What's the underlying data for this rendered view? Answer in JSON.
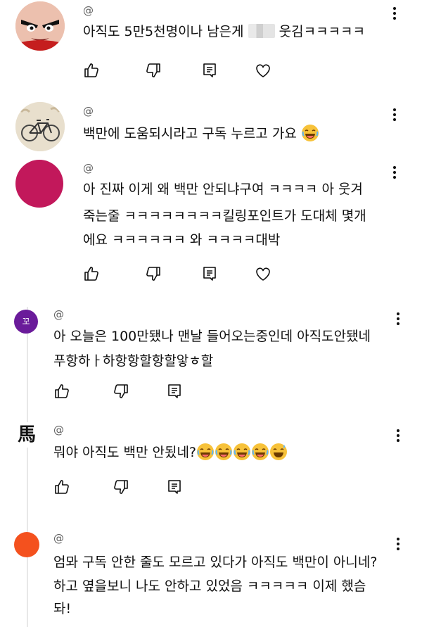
{
  "comments": [
    {
      "handle": "@",
      "text": [
        "아직도 5만5천명이나 남은게",
        "웃김ㅋㅋㅋㅋㅋ"
      ],
      "avatar": "cartoon-face-avatar"
    },
    {
      "handle": "@",
      "text": [
        "백만에 도움되시라고 구독 누르고 가요"
      ],
      "avatar": "bicycle-avatar"
    },
    {
      "handle": "@",
      "text": [
        "아 진짜 이게 왜 백만 안되냐구여 ㅋㅋㅋㅋ 아 웃겨",
        "죽는줄 ㅋㅋㅋㅋㅋㅋㅋㅋ킬링포인트가 도대체 몇개",
        "에요 ㅋㅋㅋㅋㅋㅋ 와 ㅋㅋㅋㅋ대박"
      ],
      "avatar": "magenta-circle-avatar"
    },
    {
      "handle": "@",
      "avatar_letter": "꼬",
      "text": [
        "아 오늘은 100만됐나 맨날 들어오는중인데 아직도안됐네",
        "푸항하ㅏ하항항할항할앟ㅎ할"
      ],
      "avatar": "letter-avatar"
    },
    {
      "handle": "@",
      "avatar_letter": "馬",
      "text": [
        "뭐야 아직도 백만 안됬네?"
      ],
      "avatar": "calligraphy-avatar"
    },
    {
      "handle": "@",
      "text": [
        "엄뫄 구독 안한 줄도 모르고 있다가 아직도 백만이 아니네?",
        "하고 옆을보니 나도 안하고 있었음 ㅋㅋㅋㅋㅋ 이제 했슴",
        "돠!"
      ],
      "avatar": "orange-circle-avatar"
    }
  ],
  "colors": {
    "text": "#0f0f0f",
    "secondary": "#606060",
    "magenta_avatar": "#c2185b",
    "purple_avatar": "#6a1b9a",
    "orange_avatar": "#f4511e"
  },
  "icons": [
    "thumbs-up-icon",
    "thumbs-down-icon",
    "reply-icon",
    "heart-icon",
    "more-vert-icon"
  ]
}
